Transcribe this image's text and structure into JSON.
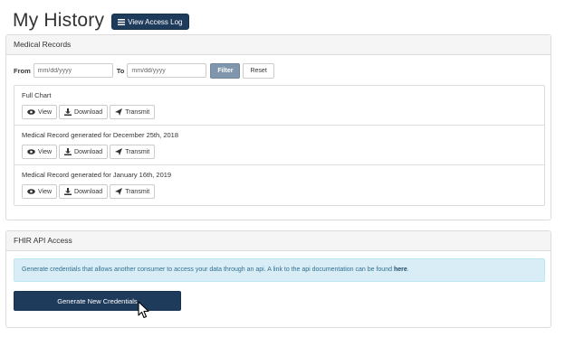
{
  "header": {
    "title": "My History",
    "access_log_label": "View Access Log"
  },
  "medical_records": {
    "heading": "Medical Records",
    "filter": {
      "from_label": "From",
      "to_label": "To",
      "from_placeholder": "mm/dd/yyyy",
      "to_placeholder": "mm/dd/yyyy",
      "filter_label": "Filter",
      "reset_label": "Reset"
    },
    "records": [
      {
        "title": "Full Chart",
        "view": "View",
        "download": "Download",
        "transmit": "Transmit"
      },
      {
        "title": "Medical Record generated for December 25th, 2018",
        "view": "View",
        "download": "Download",
        "transmit": "Transmit"
      },
      {
        "title": "Medical Record generated for January 16th, 2019",
        "view": "View",
        "download": "Download",
        "transmit": "Transmit"
      }
    ]
  },
  "fhir": {
    "heading": "FHIR API Access",
    "info_text": "Generate credentials that allows another consumer to access your data through an api. A link to the api documentation can be found ",
    "info_link": "here",
    "info_end": ".",
    "generate_label": "Generate New Credentials"
  },
  "icons": {
    "list": "list-icon",
    "view": "eye-icon",
    "download": "download-icon",
    "transmit": "send-icon",
    "cursor": "mouse-pointer-icon"
  },
  "colors": {
    "primary": "#1f3b5c",
    "filter_button": "#7f96ad",
    "info_bg": "#d9edf7",
    "info_text": "#31708f"
  }
}
